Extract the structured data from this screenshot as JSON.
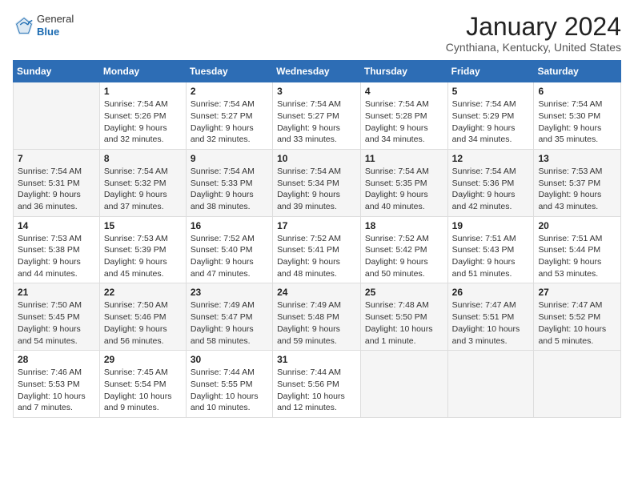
{
  "header": {
    "logo_general": "General",
    "logo_blue": "Blue",
    "month_title": "January 2024",
    "location": "Cynthiana, Kentucky, United States"
  },
  "weekdays": [
    "Sunday",
    "Monday",
    "Tuesday",
    "Wednesday",
    "Thursday",
    "Friday",
    "Saturday"
  ],
  "weeks": [
    [
      {
        "day": "",
        "sunrise": "",
        "sunset": "",
        "daylight": ""
      },
      {
        "day": "1",
        "sunrise": "Sunrise: 7:54 AM",
        "sunset": "Sunset: 5:26 PM",
        "daylight": "Daylight: 9 hours and 32 minutes."
      },
      {
        "day": "2",
        "sunrise": "Sunrise: 7:54 AM",
        "sunset": "Sunset: 5:27 PM",
        "daylight": "Daylight: 9 hours and 32 minutes."
      },
      {
        "day": "3",
        "sunrise": "Sunrise: 7:54 AM",
        "sunset": "Sunset: 5:27 PM",
        "daylight": "Daylight: 9 hours and 33 minutes."
      },
      {
        "day": "4",
        "sunrise": "Sunrise: 7:54 AM",
        "sunset": "Sunset: 5:28 PM",
        "daylight": "Daylight: 9 hours and 34 minutes."
      },
      {
        "day": "5",
        "sunrise": "Sunrise: 7:54 AM",
        "sunset": "Sunset: 5:29 PM",
        "daylight": "Daylight: 9 hours and 34 minutes."
      },
      {
        "day": "6",
        "sunrise": "Sunrise: 7:54 AM",
        "sunset": "Sunset: 5:30 PM",
        "daylight": "Daylight: 9 hours and 35 minutes."
      }
    ],
    [
      {
        "day": "7",
        "sunrise": "Sunrise: 7:54 AM",
        "sunset": "Sunset: 5:31 PM",
        "daylight": "Daylight: 9 hours and 36 minutes."
      },
      {
        "day": "8",
        "sunrise": "Sunrise: 7:54 AM",
        "sunset": "Sunset: 5:32 PM",
        "daylight": "Daylight: 9 hours and 37 minutes."
      },
      {
        "day": "9",
        "sunrise": "Sunrise: 7:54 AM",
        "sunset": "Sunset: 5:33 PM",
        "daylight": "Daylight: 9 hours and 38 minutes."
      },
      {
        "day": "10",
        "sunrise": "Sunrise: 7:54 AM",
        "sunset": "Sunset: 5:34 PM",
        "daylight": "Daylight: 9 hours and 39 minutes."
      },
      {
        "day": "11",
        "sunrise": "Sunrise: 7:54 AM",
        "sunset": "Sunset: 5:35 PM",
        "daylight": "Daylight: 9 hours and 40 minutes."
      },
      {
        "day": "12",
        "sunrise": "Sunrise: 7:54 AM",
        "sunset": "Sunset: 5:36 PM",
        "daylight": "Daylight: 9 hours and 42 minutes."
      },
      {
        "day": "13",
        "sunrise": "Sunrise: 7:53 AM",
        "sunset": "Sunset: 5:37 PM",
        "daylight": "Daylight: 9 hours and 43 minutes."
      }
    ],
    [
      {
        "day": "14",
        "sunrise": "Sunrise: 7:53 AM",
        "sunset": "Sunset: 5:38 PM",
        "daylight": "Daylight: 9 hours and 44 minutes."
      },
      {
        "day": "15",
        "sunrise": "Sunrise: 7:53 AM",
        "sunset": "Sunset: 5:39 PM",
        "daylight": "Daylight: 9 hours and 45 minutes."
      },
      {
        "day": "16",
        "sunrise": "Sunrise: 7:52 AM",
        "sunset": "Sunset: 5:40 PM",
        "daylight": "Daylight: 9 hours and 47 minutes."
      },
      {
        "day": "17",
        "sunrise": "Sunrise: 7:52 AM",
        "sunset": "Sunset: 5:41 PM",
        "daylight": "Daylight: 9 hours and 48 minutes."
      },
      {
        "day": "18",
        "sunrise": "Sunrise: 7:52 AM",
        "sunset": "Sunset: 5:42 PM",
        "daylight": "Daylight: 9 hours and 50 minutes."
      },
      {
        "day": "19",
        "sunrise": "Sunrise: 7:51 AM",
        "sunset": "Sunset: 5:43 PM",
        "daylight": "Daylight: 9 hours and 51 minutes."
      },
      {
        "day": "20",
        "sunrise": "Sunrise: 7:51 AM",
        "sunset": "Sunset: 5:44 PM",
        "daylight": "Daylight: 9 hours and 53 minutes."
      }
    ],
    [
      {
        "day": "21",
        "sunrise": "Sunrise: 7:50 AM",
        "sunset": "Sunset: 5:45 PM",
        "daylight": "Daylight: 9 hours and 54 minutes."
      },
      {
        "day": "22",
        "sunrise": "Sunrise: 7:50 AM",
        "sunset": "Sunset: 5:46 PM",
        "daylight": "Daylight: 9 hours and 56 minutes."
      },
      {
        "day": "23",
        "sunrise": "Sunrise: 7:49 AM",
        "sunset": "Sunset: 5:47 PM",
        "daylight": "Daylight: 9 hours and 58 minutes."
      },
      {
        "day": "24",
        "sunrise": "Sunrise: 7:49 AM",
        "sunset": "Sunset: 5:48 PM",
        "daylight": "Daylight: 9 hours and 59 minutes."
      },
      {
        "day": "25",
        "sunrise": "Sunrise: 7:48 AM",
        "sunset": "Sunset: 5:50 PM",
        "daylight": "Daylight: 10 hours and 1 minute."
      },
      {
        "day": "26",
        "sunrise": "Sunrise: 7:47 AM",
        "sunset": "Sunset: 5:51 PM",
        "daylight": "Daylight: 10 hours and 3 minutes."
      },
      {
        "day": "27",
        "sunrise": "Sunrise: 7:47 AM",
        "sunset": "Sunset: 5:52 PM",
        "daylight": "Daylight: 10 hours and 5 minutes."
      }
    ],
    [
      {
        "day": "28",
        "sunrise": "Sunrise: 7:46 AM",
        "sunset": "Sunset: 5:53 PM",
        "daylight": "Daylight: 10 hours and 7 minutes."
      },
      {
        "day": "29",
        "sunrise": "Sunrise: 7:45 AM",
        "sunset": "Sunset: 5:54 PM",
        "daylight": "Daylight: 10 hours and 9 minutes."
      },
      {
        "day": "30",
        "sunrise": "Sunrise: 7:44 AM",
        "sunset": "Sunset: 5:55 PM",
        "daylight": "Daylight: 10 hours and 10 minutes."
      },
      {
        "day": "31",
        "sunrise": "Sunrise: 7:44 AM",
        "sunset": "Sunset: 5:56 PM",
        "daylight": "Daylight: 10 hours and 12 minutes."
      },
      {
        "day": "",
        "sunrise": "",
        "sunset": "",
        "daylight": ""
      },
      {
        "day": "",
        "sunrise": "",
        "sunset": "",
        "daylight": ""
      },
      {
        "day": "",
        "sunrise": "",
        "sunset": "",
        "daylight": ""
      }
    ]
  ]
}
